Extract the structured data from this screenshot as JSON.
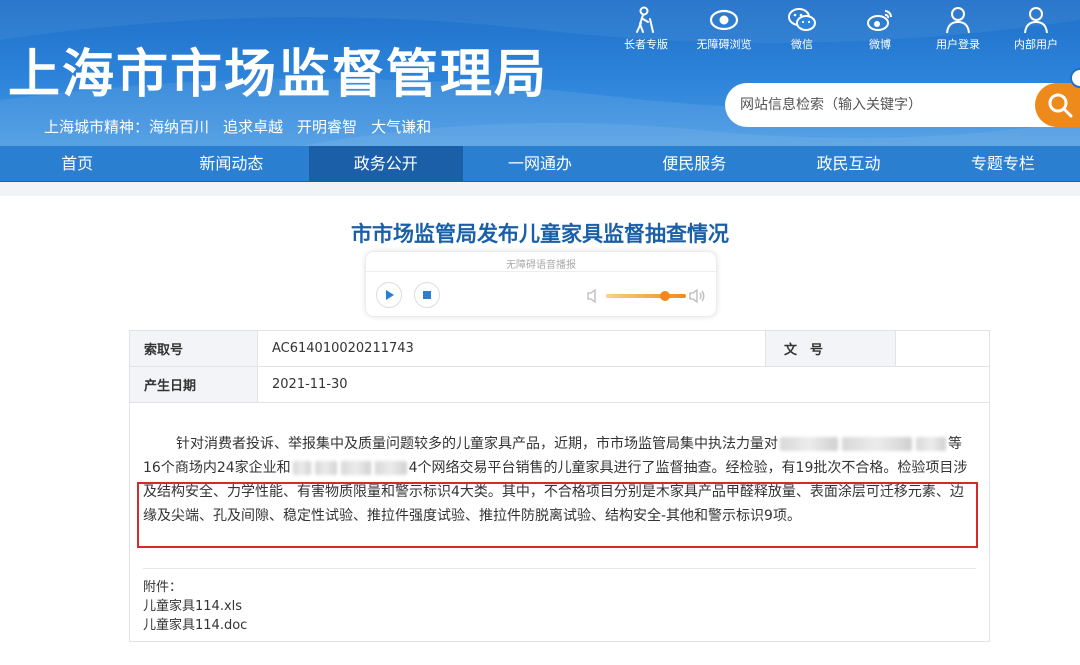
{
  "header": {
    "site_title": "上海市市场监督管理局",
    "motto_label": "上海城市精神：",
    "motto_items": [
      "海纳百川",
      "追求卓越",
      "开明睿智",
      "大气谦和"
    ],
    "quick_links": [
      {
        "label": "长者专版",
        "icon": "elder-icon"
      },
      {
        "label": "无障碍浏览",
        "icon": "eye-icon"
      },
      {
        "label": "微信",
        "icon": "wechat-icon"
      },
      {
        "label": "微博",
        "icon": "weibo-icon"
      },
      {
        "label": "用户登录",
        "icon": "user-icon"
      },
      {
        "label": "内部用户",
        "icon": "user-icon"
      }
    ],
    "search_placeholder": "网站信息检索（输入关键字）"
  },
  "nav": {
    "items": [
      "首页",
      "新闻动态",
      "政务公开",
      "一网通办",
      "便民服务",
      "政民互动",
      "专题专栏"
    ],
    "active": "政务公开"
  },
  "article": {
    "title": "市市场监管局发布儿童家具监督抽查情况",
    "player_label": "无障碍语音播报",
    "meta": {
      "index_label": "索取号",
      "index_value": "AC614010020211743",
      "doc_label": "文　号",
      "doc_value": "",
      "date_label": "产生日期",
      "date_value": "2021-11-30"
    },
    "body": {
      "part1": "针对消费者投诉、举报集中及质量问题较多的儿童家具产品，近期，市市场监管局集中执法力量对",
      "part2": "等16个商场内24家企业和",
      "part3": "4个网络交易平台销售的儿童家具进行了监督抽查。经检验，有",
      "part4": "19批次不合格。检验项目涉及结构安全、力学性能、有害物质限量和警示标识4大类。其中，不合格项目分别是木家具产品甲醛释放量、表面涂层可迁移元素、边缘及尖端、孔及间隙、稳定性试验、推拉件强度试验、推拉件防脱离试验、结构安全-其他和警示标识9项。"
    },
    "attachments_label": "附件：",
    "attachments": [
      "儿童家具114.xls",
      "儿童家具114.doc"
    ]
  },
  "colors": {
    "header_blue": "#1f6fc8",
    "nav_blue": "#2a7fd0",
    "nav_active": "#1a5fa8",
    "search_orange": "#ee8a1c",
    "highlight_red": "#d42a2a"
  }
}
